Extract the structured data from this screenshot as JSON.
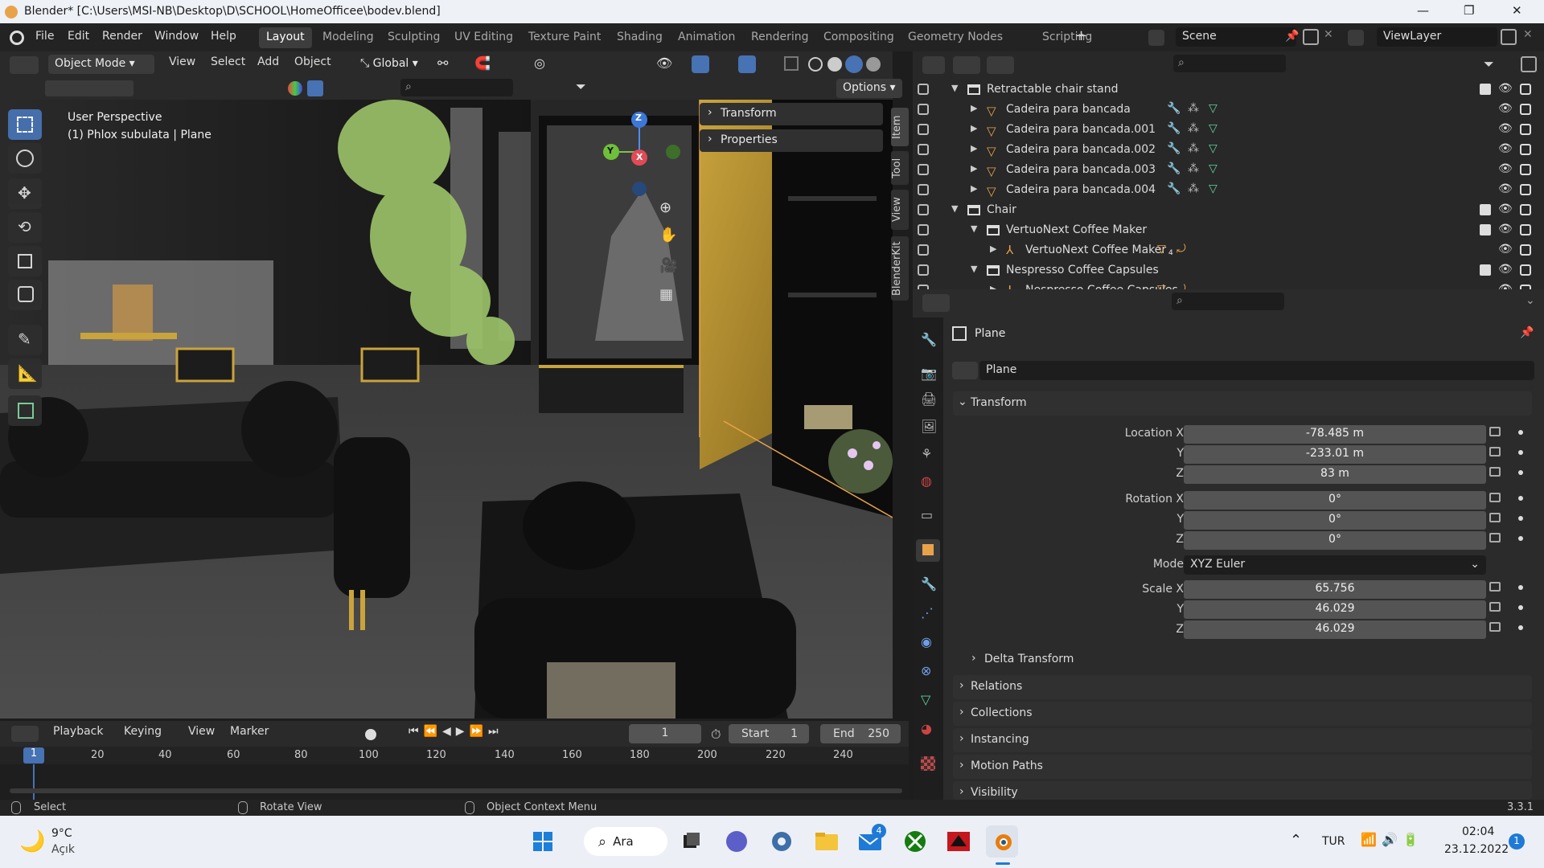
{
  "titlebar": {
    "title": "Blender* [C:\\Users\\MSI-NB\\Desktop\\D\\SCHOOL\\HomeOfficee\\bodev.blend]",
    "minimize": "—",
    "maximize": "❐",
    "close": "✕"
  },
  "menu": [
    "File",
    "Edit",
    "Render",
    "Window",
    "Help"
  ],
  "workspaces": [
    "Layout",
    "Modeling",
    "Sculpting",
    "UV Editing",
    "Texture Paint",
    "Shading",
    "Animation",
    "Rendering",
    "Compositing",
    "Geometry Nodes",
    "Scripting"
  ],
  "active_workspace": "Layout",
  "add_workspace": "+",
  "scene": "Scene",
  "view_layer": "ViewLayer",
  "viewport": {
    "mode": "Object Mode",
    "menus": [
      "View",
      "Select",
      "Add",
      "Object"
    ],
    "transform_orientation": "Global",
    "options_label": "Options",
    "perspective": "User Perspective",
    "active_object": "(1) Phlox subulata | Plane",
    "npanel_sections": [
      "Transform",
      "Properties"
    ],
    "side_tabs": [
      "Item",
      "Tool",
      "View",
      "BlenderKit"
    ],
    "gizmo_axes": {
      "x": "X",
      "y": "Y",
      "z": "Z"
    }
  },
  "timeline": {
    "menus": [
      "Playback",
      "Keying",
      "View",
      "Marker"
    ],
    "current_frame": "1",
    "start_label": "Start",
    "start": "1",
    "end_label": "End",
    "end": "250",
    "ruler": [
      "1",
      "20",
      "40",
      "60",
      "80",
      "100",
      "120",
      "140",
      "160",
      "180",
      "200",
      "220",
      "240"
    ]
  },
  "status": {
    "left": "Select",
    "middle": "Rotate View",
    "right": "Object Context Menu",
    "version": "3.3.1"
  },
  "outliner": {
    "rows": [
      {
        "label": "Retractable chair stand",
        "type": "collection",
        "indent": 0,
        "expanded": true
      },
      {
        "label": "Cadeira para bancada",
        "type": "object",
        "indent": 1
      },
      {
        "label": "Cadeira para bancada.001",
        "type": "object",
        "indent": 1
      },
      {
        "label": "Cadeira para bancada.002",
        "type": "object",
        "indent": 1
      },
      {
        "label": "Cadeira para bancada.003",
        "type": "object",
        "indent": 1
      },
      {
        "label": "Cadeira para bancada.004",
        "type": "object",
        "indent": 1
      },
      {
        "label": "Chair",
        "type": "collection",
        "indent": 0,
        "expanded": true
      },
      {
        "label": "VertuoNext Coffee Maker",
        "type": "collection",
        "indent": 1,
        "expanded": true
      },
      {
        "label": "VertuoNext Coffee Maker",
        "type": "armature",
        "indent": 2,
        "badge": "4"
      },
      {
        "label": "Nespresso Coffee Capsules",
        "type": "collection",
        "indent": 1,
        "expanded": true
      },
      {
        "label": "Nespresso Coffee Capsules",
        "type": "armature",
        "indent": 2
      }
    ]
  },
  "properties": {
    "object_name": "Plane",
    "datablock_name": "Plane",
    "transform_label": "Transform",
    "location": {
      "label": "Location X",
      "x": "-78.485 m",
      "y": "-233.01 m",
      "z": "83 m"
    },
    "rotation": {
      "label": "Rotation X",
      "x": "0°",
      "y": "0°",
      "z": "0°"
    },
    "mode_label": "Mode",
    "mode_value": "XYZ Euler",
    "scale": {
      "label": "Scale X",
      "x": "65.756",
      "y": "46.029",
      "z": "46.029"
    },
    "axis_labels": {
      "y": "Y",
      "z": "Z"
    },
    "delta": "Delta Transform",
    "sections": [
      "Relations",
      "Collections",
      "Instancing",
      "Motion Paths",
      "Visibility"
    ]
  },
  "taskbar": {
    "weather_temp": "9°C",
    "weather_desc": "Açık",
    "search": "Ara",
    "mail_badge": "4",
    "lang": "TUR",
    "time": "02:04",
    "date": "23.12.2022",
    "notif": "1"
  },
  "colors": {
    "accent": "#4772b3",
    "orange": "#e8a34a",
    "mesh_green": "#5fd29e",
    "modifier_blue": "#6f9ee6"
  }
}
